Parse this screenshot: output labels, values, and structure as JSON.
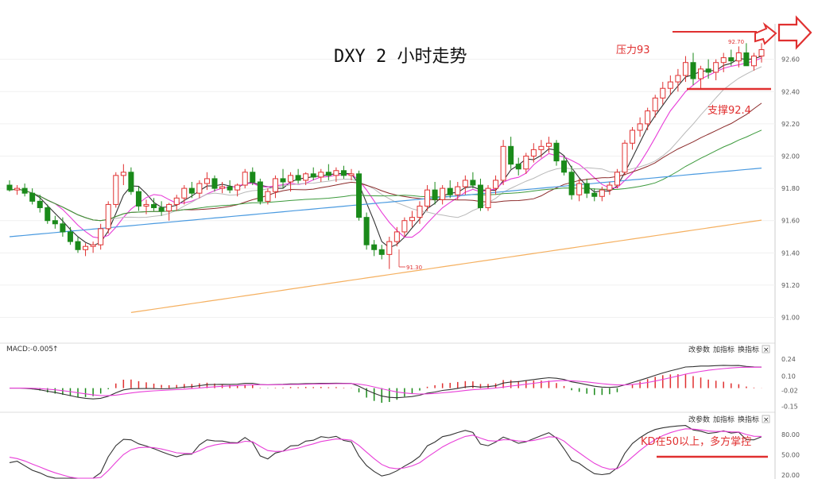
{
  "title": "DXY 2 小时走势",
  "annotations": {
    "resistance": "压力93",
    "support": "支撑92.4",
    "kd_note": "KD在50以上，多方掌控",
    "low_label": "91.30",
    "high_label": "92.70"
  },
  "panels": {
    "macd": {
      "label": "MACD:-0.005",
      "arrow": "↑"
    },
    "buttons": {
      "params": "改参数",
      "indicator": "加指标",
      "switch": "换指标",
      "close": "×"
    }
  },
  "colors": {
    "up": "#e03030",
    "down": "#1a8a1a",
    "ma_black": "#333333",
    "ma_pink": "#e83ed8",
    "ma_gray": "#b9b9b9",
    "ma_brown": "#8b2a2a",
    "ma_green": "#3c9a3c",
    "ma_blue": "#4a9ae0",
    "ma_orange": "#f5b060",
    "annotation": "#e03030"
  },
  "chart_data": [
    {
      "type": "candlestick",
      "title": "DXY 2 小时走势",
      "ylim": [
        90.85,
        92.82
      ],
      "y_ticks": [
        "92.60",
        "92.40",
        "92.20",
        "92.00",
        "91.80",
        "91.60",
        "91.40",
        "91.20",
        "91.00"
      ],
      "candles": [
        [
          91.82,
          91.85,
          91.78,
          91.79
        ],
        [
          91.79,
          91.82,
          91.76,
          91.8
        ],
        [
          91.8,
          91.83,
          91.75,
          91.77
        ],
        [
          91.77,
          91.8,
          91.7,
          91.72
        ],
        [
          91.72,
          91.76,
          91.65,
          91.68
        ],
        [
          91.68,
          91.7,
          91.58,
          91.6
        ],
        [
          91.6,
          91.63,
          91.55,
          91.58
        ],
        [
          91.58,
          91.62,
          91.5,
          91.53
        ],
        [
          91.53,
          91.56,
          91.45,
          91.47
        ],
        [
          91.47,
          91.5,
          91.4,
          91.42
        ],
        [
          91.42,
          91.46,
          91.38,
          91.44
        ],
        [
          91.44,
          91.47,
          91.4,
          91.45
        ],
        [
          91.45,
          91.58,
          91.42,
          91.55
        ],
        [
          91.55,
          91.72,
          91.52,
          91.7
        ],
        [
          91.7,
          91.9,
          91.68,
          91.88
        ],
        [
          91.88,
          91.95,
          91.82,
          91.9
        ],
        [
          91.9,
          91.93,
          91.76,
          91.78
        ],
        [
          91.78,
          91.81,
          91.66,
          91.69
        ],
        [
          91.69,
          91.73,
          91.64,
          91.7
        ],
        [
          91.7,
          91.74,
          91.66,
          91.68
        ],
        [
          91.68,
          91.72,
          91.63,
          91.66
        ],
        [
          91.66,
          91.71,
          91.6,
          91.7
        ],
        [
          91.7,
          91.76,
          91.66,
          91.74
        ],
        [
          91.74,
          91.82,
          91.7,
          91.8
        ],
        [
          91.8,
          91.84,
          91.74,
          91.77
        ],
        [
          91.77,
          91.85,
          91.74,
          91.83
        ],
        [
          91.83,
          91.9,
          91.79,
          91.86
        ],
        [
          91.86,
          91.88,
          91.78,
          91.8
        ],
        [
          91.8,
          91.84,
          91.77,
          91.81
        ],
        [
          91.81,
          91.85,
          91.77,
          91.79
        ],
        [
          91.79,
          91.83,
          91.75,
          91.82
        ],
        [
          91.82,
          91.92,
          91.8,
          91.9
        ],
        [
          91.9,
          91.93,
          91.82,
          91.84
        ],
        [
          91.84,
          91.86,
          91.7,
          91.72
        ],
        [
          91.72,
          91.8,
          91.7,
          91.78
        ],
        [
          91.78,
          91.88,
          91.74,
          91.86
        ],
        [
          91.86,
          91.92,
          91.8,
          91.84
        ],
        [
          91.84,
          91.9,
          91.78,
          91.88
        ],
        [
          91.88,
          91.92,
          91.83,
          91.85
        ],
        [
          91.85,
          91.9,
          91.82,
          91.89
        ],
        [
          91.89,
          91.93,
          91.85,
          91.87
        ],
        [
          91.87,
          91.92,
          91.84,
          91.9
        ],
        [
          91.9,
          91.95,
          91.85,
          91.88
        ],
        [
          91.88,
          91.93,
          91.84,
          91.91
        ],
        [
          91.91,
          91.94,
          91.86,
          91.88
        ],
        [
          91.88,
          91.92,
          91.85,
          91.89
        ],
        [
          91.89,
          91.91,
          91.6,
          91.62
        ],
        [
          91.62,
          91.65,
          91.42,
          91.45
        ],
        [
          91.45,
          91.48,
          91.38,
          91.42
        ],
        [
          91.42,
          91.45,
          91.36,
          91.39
        ],
        [
          91.39,
          91.5,
          91.3,
          91.47
        ],
        [
          91.47,
          91.56,
          91.44,
          91.53
        ],
        [
          91.53,
          91.62,
          91.5,
          91.6
        ],
        [
          91.6,
          91.66,
          91.56,
          91.62
        ],
        [
          91.62,
          91.72,
          91.58,
          91.69
        ],
        [
          91.69,
          91.82,
          91.66,
          91.79
        ],
        [
          91.79,
          91.84,
          91.7,
          91.73
        ],
        [
          91.73,
          91.82,
          91.7,
          91.8
        ],
        [
          91.8,
          91.85,
          91.74,
          91.76
        ],
        [
          91.76,
          91.84,
          91.73,
          91.81
        ],
        [
          91.81,
          91.88,
          91.76,
          91.85
        ],
        [
          91.85,
          91.9,
          91.8,
          91.82
        ],
        [
          91.82,
          91.86,
          91.66,
          91.68
        ],
        [
          91.68,
          91.82,
          91.66,
          91.8
        ],
        [
          91.8,
          91.88,
          91.76,
          91.85
        ],
        [
          91.85,
          92.1,
          91.82,
          92.06
        ],
        [
          92.06,
          92.12,
          91.92,
          91.95
        ],
        [
          91.95,
          91.99,
          91.88,
          91.92
        ],
        [
          91.92,
          92.02,
          91.89,
          92.0
        ],
        [
          92.0,
          92.08,
          91.96,
          92.04
        ],
        [
          92.04,
          92.1,
          91.99,
          92.06
        ],
        [
          92.06,
          92.12,
          92.02,
          92.08
        ],
        [
          92.08,
          92.1,
          91.94,
          91.97
        ],
        [
          91.97,
          92.0,
          91.88,
          91.9
        ],
        [
          91.9,
          91.94,
          91.73,
          91.76
        ],
        [
          91.76,
          91.86,
          91.72,
          91.83
        ],
        [
          91.83,
          91.86,
          91.74,
          91.77
        ],
        [
          91.77,
          91.8,
          91.72,
          91.75
        ],
        [
          91.75,
          91.81,
          91.72,
          91.79
        ],
        [
          91.79,
          91.84,
          91.76,
          91.82
        ],
        [
          91.82,
          91.92,
          91.8,
          91.9
        ],
        [
          91.9,
          92.1,
          91.88,
          92.08
        ],
        [
          92.08,
          92.18,
          92.04,
          92.16
        ],
        [
          92.16,
          92.24,
          92.12,
          92.2
        ],
        [
          92.2,
          92.3,
          92.16,
          92.28
        ],
        [
          92.28,
          92.38,
          92.24,
          92.36
        ],
        [
          92.36,
          92.46,
          92.32,
          92.42
        ],
        [
          92.42,
          92.5,
          92.38,
          92.46
        ],
        [
          92.46,
          92.54,
          92.4,
          92.5
        ],
        [
          92.5,
          92.62,
          92.46,
          92.58
        ],
        [
          92.58,
          92.64,
          92.44,
          92.48
        ],
        [
          92.48,
          92.56,
          92.42,
          92.54
        ],
        [
          92.54,
          92.6,
          92.48,
          92.52
        ],
        [
          92.52,
          92.6,
          92.47,
          92.58
        ],
        [
          92.58,
          92.64,
          92.52,
          92.61
        ],
        [
          92.61,
          92.66,
          92.56,
          92.59
        ],
        [
          92.59,
          92.68,
          92.55,
          92.64
        ],
        [
          92.64,
          92.7,
          92.58,
          92.56
        ],
        [
          92.56,
          92.64,
          92.53,
          92.62
        ],
        [
          92.62,
          92.7,
          92.58,
          92.66
        ]
      ]
    },
    {
      "type": "line",
      "label": "MACD:-0.005",
      "ylim": [
        -0.18,
        0.28
      ],
      "y_ticks": [
        "0.24",
        "0.10",
        "-0.02",
        "-0.15"
      ]
    },
    {
      "type": "line",
      "label": "KD",
      "ylim": [
        15,
        95
      ],
      "y_ticks": [
        "80.00",
        "50.00",
        "20.00"
      ]
    }
  ]
}
